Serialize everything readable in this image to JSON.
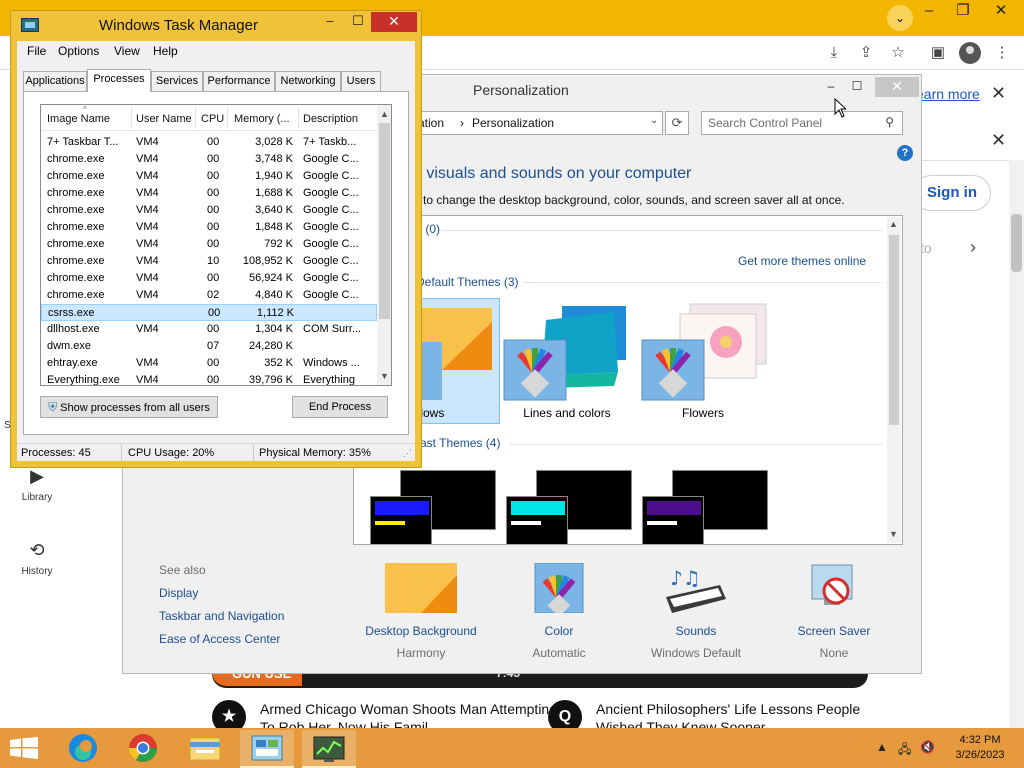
{
  "browser": {
    "learn_more": "earn more",
    "sign_in": "Sign in",
    "side_text": "to",
    "sidebar": [
      {
        "label": "Library",
        "icon": "library-icon"
      },
      {
        "label": "History",
        "icon": "history-icon"
      }
    ],
    "side_letter": "S",
    "video_label": "GUN USE",
    "video_duration": "7:43",
    "news": [
      {
        "title": "Armed Chicago Woman Shoots Man Attempting To Rob Her, Now His Famil"
      },
      {
        "title": "Ancient Philosophers' Life Lessons People Wished They Knew Sooner",
        "logo": "Q"
      }
    ],
    "accent": "#f2b600"
  },
  "personalization": {
    "title": "Personalization",
    "address": {
      "parent": "ation",
      "sep": "›",
      "current": "Personalization"
    },
    "search_placeholder": "Search Control Panel",
    "heading": "e visuals and sounds on your computer",
    "subheading": "e to change the desktop background, color, sounds, and screen saver all at once.",
    "themes_group_mine": "s (0)",
    "get_more": "Get more themes online",
    "default_group": "Default Themes (3)",
    "contrast_group": "rast Themes (4)",
    "themes": [
      {
        "label": "ndows",
        "selected": true
      },
      {
        "label": "Lines and colors",
        "selected": false
      },
      {
        "label": "Flowers",
        "selected": false
      }
    ],
    "contrast_colors": [
      {
        "bar": "#1a1aff",
        "line": "#ffeb00"
      },
      {
        "bar": "#00e6e6",
        "line": "#ffffff"
      },
      {
        "bar": "#4b0f8c",
        "line": "#ffffff"
      }
    ],
    "see_also": {
      "title": "See also",
      "links": [
        "Display",
        "Taskbar and Navigation",
        "Ease of Access Center"
      ]
    },
    "bottom": [
      {
        "label": "Desktop Background",
        "value": "Harmony",
        "icon": "desktop-background-icon"
      },
      {
        "label": "Color",
        "value": "Automatic",
        "icon": "color-icon"
      },
      {
        "label": "Sounds",
        "value": "Windows Default",
        "icon": "sounds-icon"
      },
      {
        "label": "Screen Saver",
        "value": "None",
        "icon": "screen-saver-icon"
      }
    ]
  },
  "task_manager": {
    "title": "Windows Task Manager",
    "menus": [
      "File",
      "Options",
      "View",
      "Help"
    ],
    "tabs": [
      "Applications",
      "Processes",
      "Services",
      "Performance",
      "Networking",
      "Users"
    ],
    "active_tab": "Processes",
    "columns": [
      "Image Name",
      "User Name",
      "CPU",
      "Memory (...",
      "Description"
    ],
    "rows": [
      {
        "name": "7+ Taskbar T...",
        "user": "VM4",
        "cpu": "00",
        "mem": "3,028 K",
        "desc": "7+ Taskb..."
      },
      {
        "name": "chrome.exe",
        "user": "VM4",
        "cpu": "00",
        "mem": "3,748 K",
        "desc": "Google C..."
      },
      {
        "name": "chrome.exe",
        "user": "VM4",
        "cpu": "00",
        "mem": "1,940 K",
        "desc": "Google C..."
      },
      {
        "name": "chrome.exe",
        "user": "VM4",
        "cpu": "00",
        "mem": "1,688 K",
        "desc": "Google C..."
      },
      {
        "name": "chrome.exe",
        "user": "VM4",
        "cpu": "00",
        "mem": "3,640 K",
        "desc": "Google C..."
      },
      {
        "name": "chrome.exe",
        "user": "VM4",
        "cpu": "00",
        "mem": "1,848 K",
        "desc": "Google C..."
      },
      {
        "name": "chrome.exe",
        "user": "VM4",
        "cpu": "00",
        "mem": "792 K",
        "desc": "Google C..."
      },
      {
        "name": "chrome.exe",
        "user": "VM4",
        "cpu": "10",
        "mem": "108,952 K",
        "desc": "Google C..."
      },
      {
        "name": "chrome.exe",
        "user": "VM4",
        "cpu": "00",
        "mem": "56,924 K",
        "desc": "Google C..."
      },
      {
        "name": "chrome.exe",
        "user": "VM4",
        "cpu": "02",
        "mem": "4,840 K",
        "desc": "Google C..."
      },
      {
        "name": "csrss.exe",
        "user": "",
        "cpu": "00",
        "mem": "1,112 K",
        "desc": "",
        "selected": true
      },
      {
        "name": "dllhost.exe",
        "user": "VM4",
        "cpu": "00",
        "mem": "1,304 K",
        "desc": "COM Surr..."
      },
      {
        "name": "dwm.exe",
        "user": "",
        "cpu": "07",
        "mem": "24,280 K",
        "desc": ""
      },
      {
        "name": "ehtray.exe",
        "user": "VM4",
        "cpu": "00",
        "mem": "352 K",
        "desc": "Windows ..."
      },
      {
        "name": "Everything.exe",
        "user": "VM4",
        "cpu": "00",
        "mem": "39,796 K",
        "desc": "Everything"
      }
    ],
    "show_all_label": "Show processes from all users",
    "end_process_label": "End Process",
    "status": {
      "processes": "Processes: 45",
      "cpu": "CPU Usage: 20%",
      "memory": "Physical Memory: 35%"
    }
  },
  "taskbar": {
    "time": "4:32 PM",
    "date": "3/26/2023",
    "color": "#e69a3d",
    "apps": [
      {
        "icon": "edge-icon"
      },
      {
        "icon": "chrome-icon"
      },
      {
        "icon": "file-explorer-icon"
      },
      {
        "icon": "control-panel-icon",
        "active": true
      },
      {
        "icon": "task-manager-icon",
        "active": true
      }
    ]
  }
}
